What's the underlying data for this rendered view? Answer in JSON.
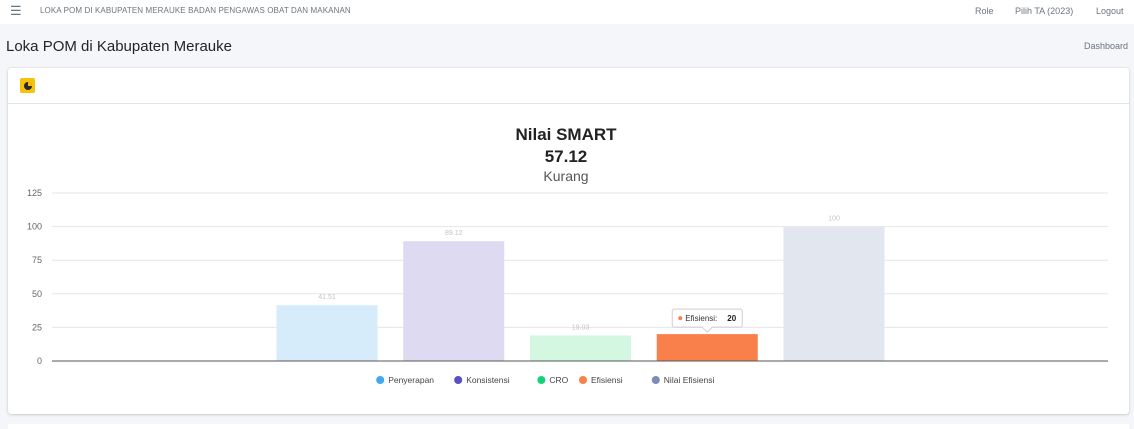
{
  "topbar": {
    "menu_icon": "hamburger-icon",
    "title": "LOKA POM DI KABUPATEN MERAUKE BADAN PENGAWAS OBAT DAN MAKANAN",
    "nav": {
      "role": "Role",
      "year": "Pilih TA (2023)",
      "logout": "Logout"
    }
  },
  "header": {
    "title": "Loka POM di Kabupaten Merauke",
    "breadcrumb": "Dashboard"
  },
  "card": {
    "tool_icon": "pie-chart-icon"
  },
  "chart_data": {
    "type": "bar",
    "title": "Nilai SMART",
    "subtitle_value": "57.12",
    "subtitle_text": "Kurang",
    "categories": [
      "Penyerapan",
      "Konsistensi",
      "CRO",
      "Efisiensi",
      "Nilai Efisiensi"
    ],
    "values": [
      41.51,
      89.12,
      19.03,
      20,
      100
    ],
    "data_labels": [
      "41.51",
      "89.12",
      "19.03",
      "",
      "100"
    ],
    "colors": [
      "#d6ecfb",
      "#dedaf2",
      "#d4f7e1",
      "#f97f4b",
      "#e1e6ef"
    ],
    "legend_colors": [
      "#3fa8ef",
      "#5a4fc2",
      "#18d27a",
      "#f97f4b",
      "#7d8cb5"
    ],
    "ylim": [
      0,
      125
    ],
    "yticks": [
      0,
      25,
      50,
      75,
      100,
      125
    ],
    "legend_position": "bottom",
    "tooltip": {
      "label": "Efisiensi:",
      "value": "20"
    },
    "grid": true
  }
}
